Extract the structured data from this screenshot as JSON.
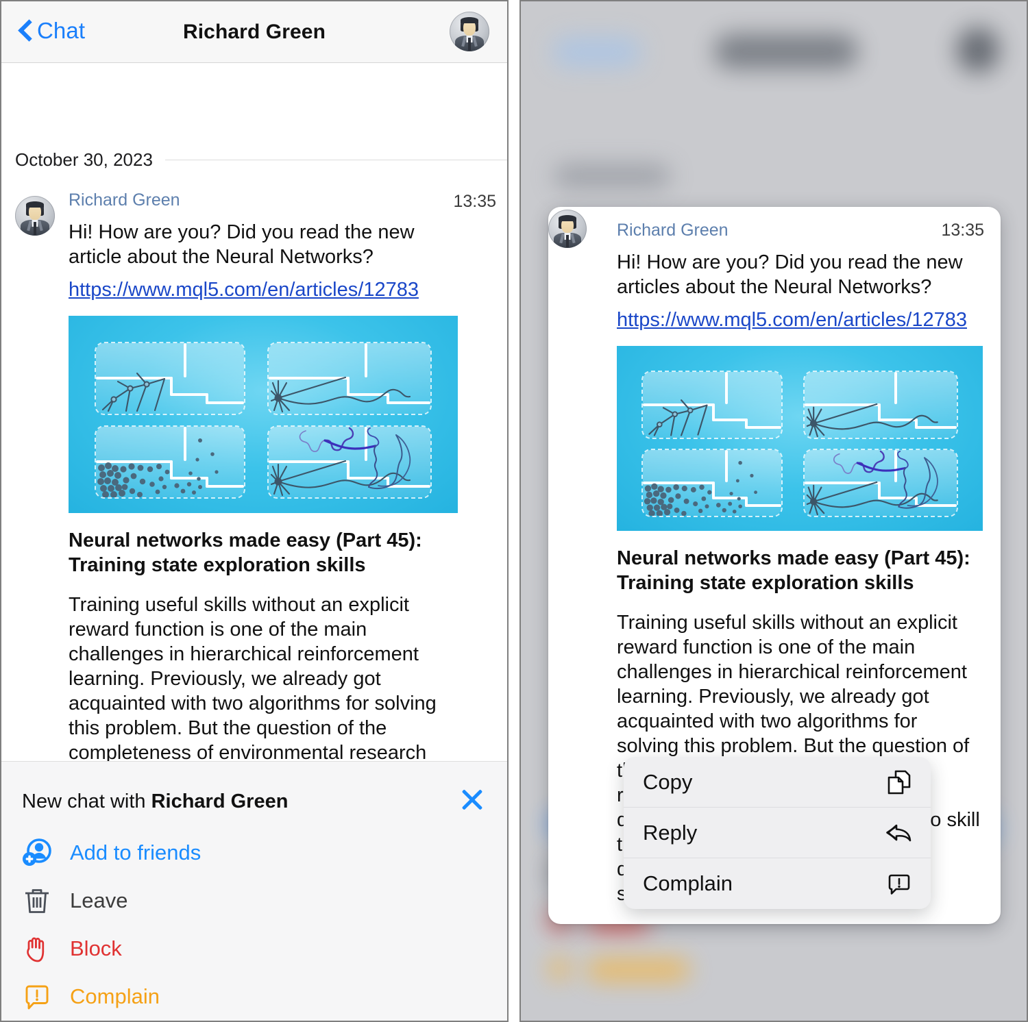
{
  "app": {
    "accent_blue": "#1a7ffb",
    "link_blue": "#1a47c8",
    "sender_blue": "#5d7fad",
    "danger_red": "#e03232",
    "warn_orange": "#f5a116",
    "neutral_gray": "#4a4f58"
  },
  "left_panel": {
    "navbar": {
      "back_label": "Chat",
      "title": "Richard Green",
      "back_icon": "chevron-left-icon",
      "avatar_icon": "user-avatar"
    },
    "date_divider": "October 30, 2023",
    "message": {
      "sender": "Richard Green",
      "time": "13:35",
      "text": "Hi! How are you? Did you read the new article about the Neural Networks?",
      "link": "https://www.mql5.com/en/articles/12783",
      "article": {
        "title": "Neural networks made easy (Part 45): Training state exploration skills",
        "description": "Training useful skills without an explicit reward function is one of the main challenges in hierarchical reinforcement learning. Previously, we already got acquainted with two algorithms for solving this problem. But the question of the completeness of environmental research remains open. This article demonstrates a different approach to skill training, the use of which directly depends on the current state of the system."
      }
    },
    "action_panel": {
      "header_prefix": "New chat with ",
      "header_name": "Richard Green",
      "close_icon": "close-icon",
      "items": [
        {
          "label": "Add to friends",
          "icon": "add-person-icon",
          "color": "#1a8cff"
        },
        {
          "label": "Leave",
          "icon": "trash-icon",
          "color": "#4a4f58"
        },
        {
          "label": "Block",
          "icon": "hand-stop-icon",
          "color": "#e03232"
        },
        {
          "label": "Complain",
          "icon": "complain-icon",
          "color": "#f5a116"
        }
      ]
    }
  },
  "right_panel": {
    "message": {
      "sender": "Richard Green",
      "time": "13:35",
      "text": "Hi! How are you? Did you read the new articles about the Neural Networks?",
      "link": "https://www.mql5.com/en/articles/12783",
      "article": {
        "title": "Neural networks made easy (Part 45): Training state exploration skills",
        "description": "Training useful skills without an explicit reward function is one of the main challenges in hierarchical reinforcement learning. Previously, we already got acquainted with two algorithms for solving this problem. But the question of the completeness of environmental research remains open. This article demonstrates a different approach to skill training, the use of which directly depends on the current state of the system."
      }
    },
    "context_menu": {
      "items": [
        {
          "label": "Copy",
          "icon": "copy-icon"
        },
        {
          "label": "Reply",
          "icon": "reply-arrow-icon"
        },
        {
          "label": "Complain",
          "icon": "complain-icon"
        }
      ]
    }
  }
}
